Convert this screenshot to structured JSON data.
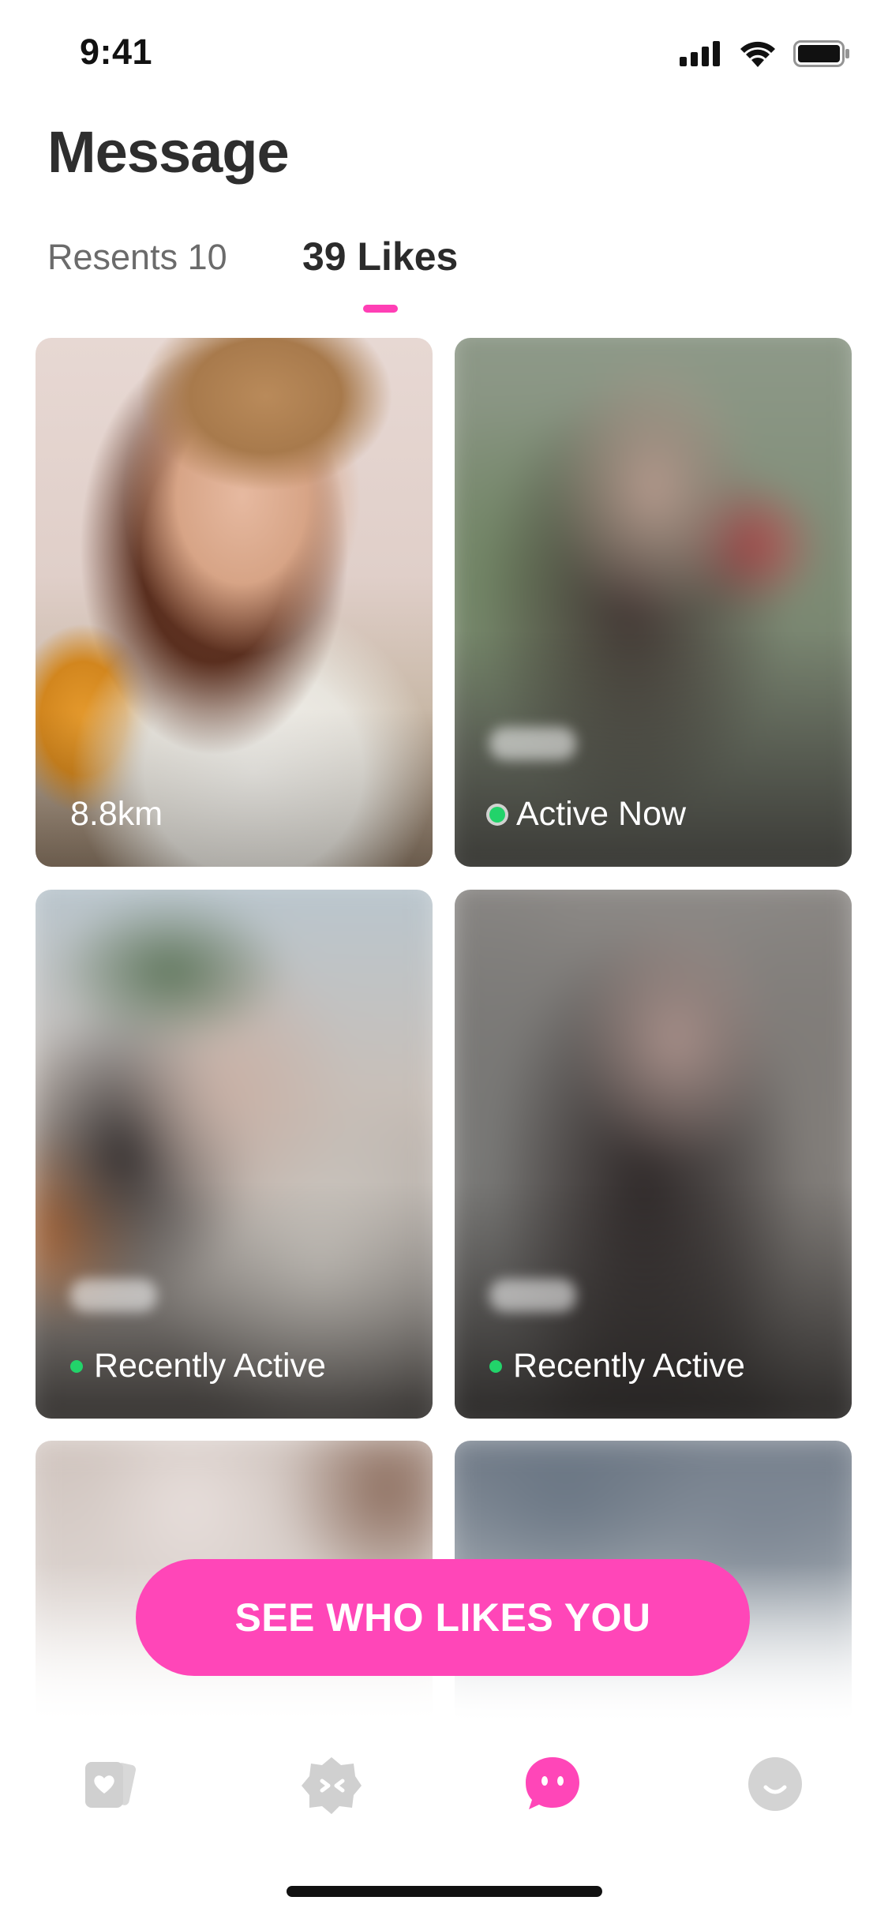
{
  "status_bar": {
    "time": "9:41"
  },
  "header": {
    "title": "Message"
  },
  "tabs": [
    {
      "label": "Resents 10",
      "selected": false
    },
    {
      "label": "39 Likes",
      "selected": true
    }
  ],
  "cards": [
    {
      "status": "8.8km",
      "indicator": "none"
    },
    {
      "status": "Active Now",
      "indicator": "active-now"
    },
    {
      "status": "Recently Active",
      "indicator": "recently-active"
    },
    {
      "status": "Recently Active",
      "indicator": "recently-active"
    }
  ],
  "cta": {
    "label": "SEE WHO LIKES YOU"
  },
  "tabbar": {
    "items": [
      {
        "icon": "cards-heart-icon",
        "active": false
      },
      {
        "icon": "explore-badge-icon",
        "active": false
      },
      {
        "icon": "chat-bubble-icon",
        "active": true
      },
      {
        "icon": "profile-smile-icon",
        "active": false
      }
    ]
  },
  "colors": {
    "accent": "#ff46b8",
    "active_green": "#22d36a",
    "inactive_icon": "#d3d3d3"
  }
}
